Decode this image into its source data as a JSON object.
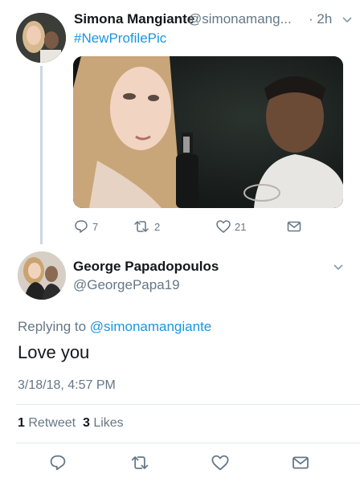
{
  "tweet": {
    "author_name": "Simona Mangiante",
    "author_handle": "@simonamang...",
    "time": "· 2h",
    "hashtag": "#NewProfilePic",
    "replies": "7",
    "retweets": "2",
    "likes": "21"
  },
  "reply": {
    "author_name": "George Papadopoulos",
    "author_handle": "@GeorgePapa19",
    "replying_prefix": "Replying to",
    "replying_to": "@simonamangiante",
    "text": "Love you",
    "timestamp": "3/18/18, 4:57 PM",
    "retweet_count": "1",
    "retweet_label": "Retweet",
    "like_count": "3",
    "like_label": "Likes"
  },
  "icons": {
    "reply": "reply-icon",
    "retweet": "retweet-icon",
    "like": "heart-icon",
    "message": "envelope-icon",
    "more": "chevron-down-icon"
  },
  "colors": {
    "link": "#1b95e0",
    "muted": "#657786",
    "text": "#14171a",
    "divider": "#e1e8ed"
  }
}
